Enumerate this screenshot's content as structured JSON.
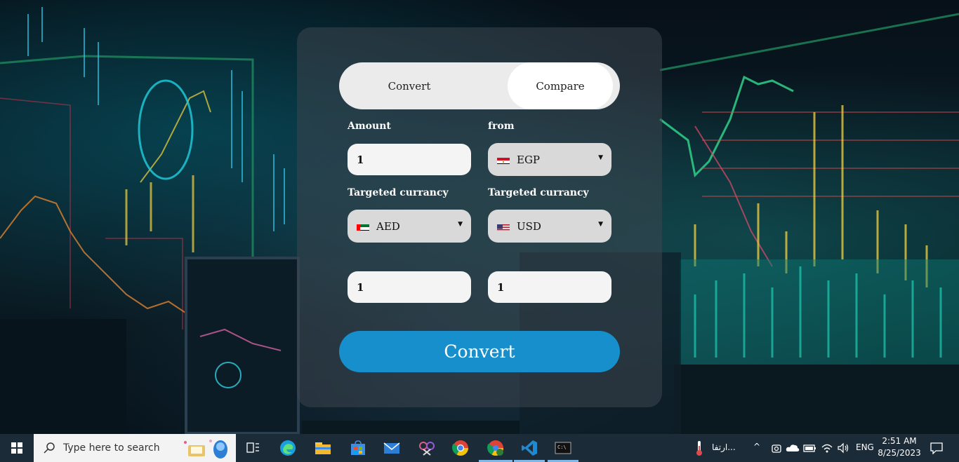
{
  "form": {
    "tabs": {
      "convert": "Convert",
      "compare": "Compare",
      "active": "Compare"
    },
    "amount_label": "Amount",
    "amount_value": "1",
    "from_label": "from",
    "from_currency": "EGP",
    "target1_label": "Targeted currancy",
    "target1_currency": "AED",
    "target2_label": "Targeted currancy",
    "target2_currency": "USD",
    "result1_value": "1",
    "result2_value": "1",
    "convert_button": "Convert"
  },
  "taskbar": {
    "search_placeholder": "Type here to search",
    "weather_text": "ارتفا...",
    "language": "ENG",
    "time": "2:51 AM",
    "date": "8/25/2023"
  },
  "colors": {
    "accent": "#168fcc",
    "taskbar": "#1c2b38"
  }
}
